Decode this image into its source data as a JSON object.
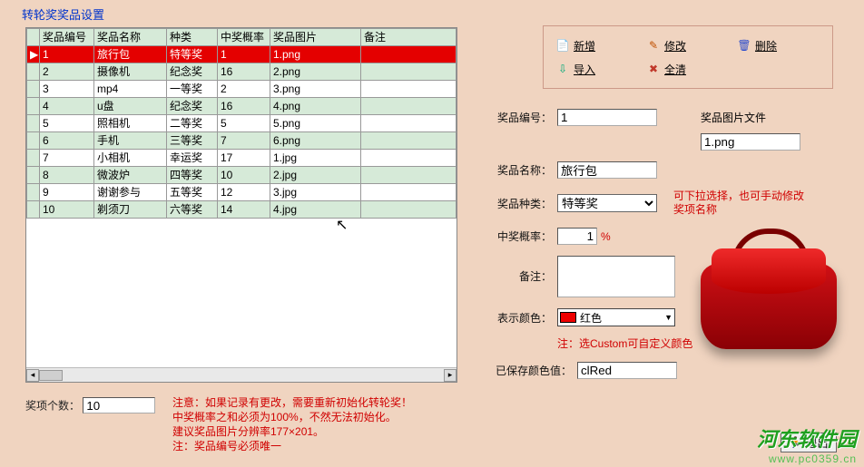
{
  "title": "转轮奖奖品设置",
  "columns": [
    "奖品编号",
    "奖品名称",
    "种类",
    "中奖概率",
    "奖品图片",
    "备注"
  ],
  "rows": [
    {
      "id": "1",
      "name": "旅行包",
      "kind": "特等奖",
      "rate": "1",
      "img": "1.png",
      "note": "",
      "sel": true
    },
    {
      "id": "2",
      "name": "摄像机",
      "kind": "纪念奖",
      "rate": "16",
      "img": "2.png",
      "note": ""
    },
    {
      "id": "3",
      "name": "mp4",
      "kind": "一等奖",
      "rate": "2",
      "img": "3.png",
      "note": ""
    },
    {
      "id": "4",
      "name": "u盘",
      "kind": "纪念奖",
      "rate": "16",
      "img": "4.png",
      "note": ""
    },
    {
      "id": "5",
      "name": "照相机",
      "kind": "二等奖",
      "rate": "5",
      "img": "5.png",
      "note": ""
    },
    {
      "id": "6",
      "name": "手机",
      "kind": "三等奖",
      "rate": "7",
      "img": "6.png",
      "note": ""
    },
    {
      "id": "7",
      "name": "小相机",
      "kind": "幸运奖",
      "rate": "17",
      "img": "1.jpg",
      "note": ""
    },
    {
      "id": "8",
      "name": "微波炉",
      "kind": "四等奖",
      "rate": "10",
      "img": "2.jpg",
      "note": ""
    },
    {
      "id": "9",
      "name": "谢谢参与",
      "kind": "五等奖",
      "rate": "12",
      "img": "3.jpg",
      "note": ""
    },
    {
      "id": "10",
      "name": "剃须刀",
      "kind": "六等奖",
      "rate": "14",
      "img": "4.jpg",
      "note": ""
    }
  ],
  "toolbar": {
    "add": "新增",
    "edit": "修改",
    "del": "删除",
    "import": "导入",
    "clear": "全清"
  },
  "form": {
    "id_label": "奖品编号：",
    "id_value": "1",
    "imgfile_label": "奖品图片文件",
    "imgfile_value": "1.png",
    "name_label": "奖品名称：",
    "name_value": "旅行包",
    "kind_label": "奖品种类：",
    "kind_value": "特等奖",
    "kind_hint": "可下拉选择，也可手动修改奖项名称",
    "rate_label": "中奖概率：",
    "rate_value": "1",
    "rate_unit": "%",
    "note_label": "备注：",
    "note_value": "",
    "color_label": "表示颜色：",
    "color_value": "红色",
    "color_hint": "注：选Custom可自定义颜色",
    "saved_color_label": "已保存颜色值：",
    "saved_color_value": "clRed"
  },
  "count_label": "奖项个数：",
  "count_value": "10",
  "warn_lines": [
    "注意：如果记录有更改，需要重新初始化转轮奖！",
    "中奖概率之和必须为100%，不然无法初始化。",
    "建议奖品图片分辨率177×201。",
    "注：奖品编号必须唯一"
  ],
  "exit_label": "退出",
  "watermark_cn": "河东软件园",
  "watermark_en": "www.pc0359.cn"
}
